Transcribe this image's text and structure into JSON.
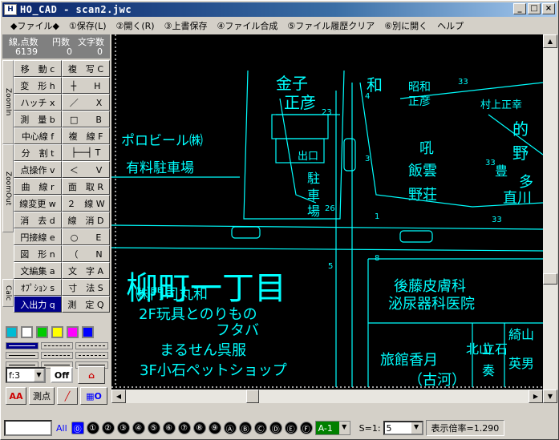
{
  "window": {
    "title": "HO_CAD - scan2.jwc",
    "minimize": "_",
    "maximize": "□",
    "close": "×"
  },
  "menu": [
    {
      "label": "◆ファイル◆"
    },
    {
      "label": "①保存(L)"
    },
    {
      "label": "②開く(R)"
    },
    {
      "label": "③上書保存"
    },
    {
      "label": "④ファイル合成"
    },
    {
      "label": "⑤ファイル履歴クリア"
    },
    {
      "label": "⑥別に開く"
    },
    {
      "label": "ヘルプ"
    }
  ],
  "stats": {
    "label1": "線,点数",
    "label2": "円数",
    "label3": "文字数",
    "value1": "6139",
    "value2": "0",
    "value3": "0"
  },
  "side_tabs": {
    "zoom_in": "ZoomIn",
    "zoom_out": "ZoomOut",
    "calc": "Calc"
  },
  "commands": [
    {
      "label": "移　動 c"
    },
    {
      "label": "複　写 C"
    },
    {
      "label": "変　形 h"
    },
    {
      "label": "┼　　H"
    },
    {
      "label": "ハッチ x"
    },
    {
      "label": "／　　X"
    },
    {
      "label": "測　量 b"
    },
    {
      "label": "□　　B"
    },
    {
      "label": "中心線 f"
    },
    {
      "label": "複　線 F"
    },
    {
      "label": "分　割 t"
    },
    {
      "label": "├──┤ T"
    },
    {
      "label": "点操作 v"
    },
    {
      "label": "＜　　V"
    },
    {
      "label": "曲　線 r"
    },
    {
      "label": "面　取 R"
    },
    {
      "label": "線変更 w"
    },
    {
      "label": "２　線 W"
    },
    {
      "label": "消　去 d"
    },
    {
      "label": "線　消 D"
    },
    {
      "label": "円接線 e"
    },
    {
      "label": "○　　E"
    },
    {
      "label": "図　形 n"
    },
    {
      "label": "（　　N"
    },
    {
      "label": "文編集 a"
    },
    {
      "label": "文　字 A"
    },
    {
      "label": "ｵﾌﾟｼｮﾝ s"
    },
    {
      "label": "寸　法 S"
    },
    {
      "label": "入出力 q",
      "active": true
    },
    {
      "label": "測　定 Q"
    }
  ],
  "palette": [
    "#00bcd4",
    "#ffffff",
    "#00cc00",
    "#ffff00",
    "#ff00ff",
    "#0000ff"
  ],
  "font_select": "f:3",
  "off_button": "Off",
  "measure_point": "測点",
  "grid_toggle": "O",
  "aa_label": "AA",
  "status": {
    "all_label": "All",
    "layers": [
      "⓪",
      "①",
      "②",
      "③",
      "④",
      "⑤",
      "⑥",
      "⑦",
      "⑧",
      "⑨",
      "Ⓐ",
      "Ⓑ",
      "Ⓒ",
      "Ⓓ",
      "Ⓔ",
      "Ⓕ"
    ],
    "layer_group": "A-1",
    "scale_label": "S=1:",
    "scale_value": "5",
    "zoom": "表示倍率=1.290"
  },
  "drawing": {
    "texts": [
      {
        "t": "金子",
        "size": 20
      },
      {
        "t": "正彦",
        "size": 20
      },
      {
        "t": "和",
        "size": 20
      },
      {
        "t": "昭和",
        "size": 14
      },
      {
        "t": "正彦",
        "size": 14
      },
      {
        "t": "村上正幸",
        "size": 13
      },
      {
        "t": "的",
        "size": 20
      },
      {
        "t": "野",
        "size": 20
      },
      {
        "t": "豊",
        "size": 16
      },
      {
        "t": "ポロビール㈱",
        "size": 17
      },
      {
        "t": "有料駐車場",
        "size": 17
      },
      {
        "t": "出口",
        "size": 13
      },
      {
        "t": "駐",
        "size": 16
      },
      {
        "t": "車",
        "size": 16
      },
      {
        "t": "場",
        "size": 16
      },
      {
        "t": "吼",
        "size": 18
      },
      {
        "t": "飯雲",
        "size": 18
      },
      {
        "t": "野荘",
        "size": 18
      },
      {
        "t": "多",
        "size": 18
      },
      {
        "t": "直川",
        "size": 18
      },
      {
        "t": "柳町一丁目",
        "size": 40
      },
      {
        "t": "後藤皮膚科",
        "size": 18
      },
      {
        "t": "泌尿器科医院",
        "size": 18
      },
      {
        "t": "㈱門司丸和",
        "size": 18
      },
      {
        "t": "2F玩具とのりもの",
        "size": 18
      },
      {
        "t": "フタバ",
        "size": 18
      },
      {
        "t": "まるせん呉服",
        "size": 18
      },
      {
        "t": "3F小石ペットショップ",
        "size": 18
      },
      {
        "t": "旅館香月",
        "size": 18
      },
      {
        "t": "（古河）",
        "size": 18
      },
      {
        "t": "北山",
        "size": 16
      },
      {
        "t": "立石",
        "size": 16
      },
      {
        "t": "奏",
        "size": 16
      },
      {
        "t": "綺山",
        "size": 16
      },
      {
        "t": "英男",
        "size": 16
      },
      {
        "t": "23",
        "size": 10
      },
      {
        "t": "33",
        "size": 10
      },
      {
        "t": "33",
        "size": 10
      },
      {
        "t": "33",
        "size": 10
      },
      {
        "t": "5",
        "size": 10
      },
      {
        "t": "8",
        "size": 10
      },
      {
        "t": "1",
        "size": 10
      },
      {
        "t": "3",
        "size": 10
      },
      {
        "t": "26",
        "size": 10
      },
      {
        "t": "4",
        "size": 10
      }
    ]
  }
}
